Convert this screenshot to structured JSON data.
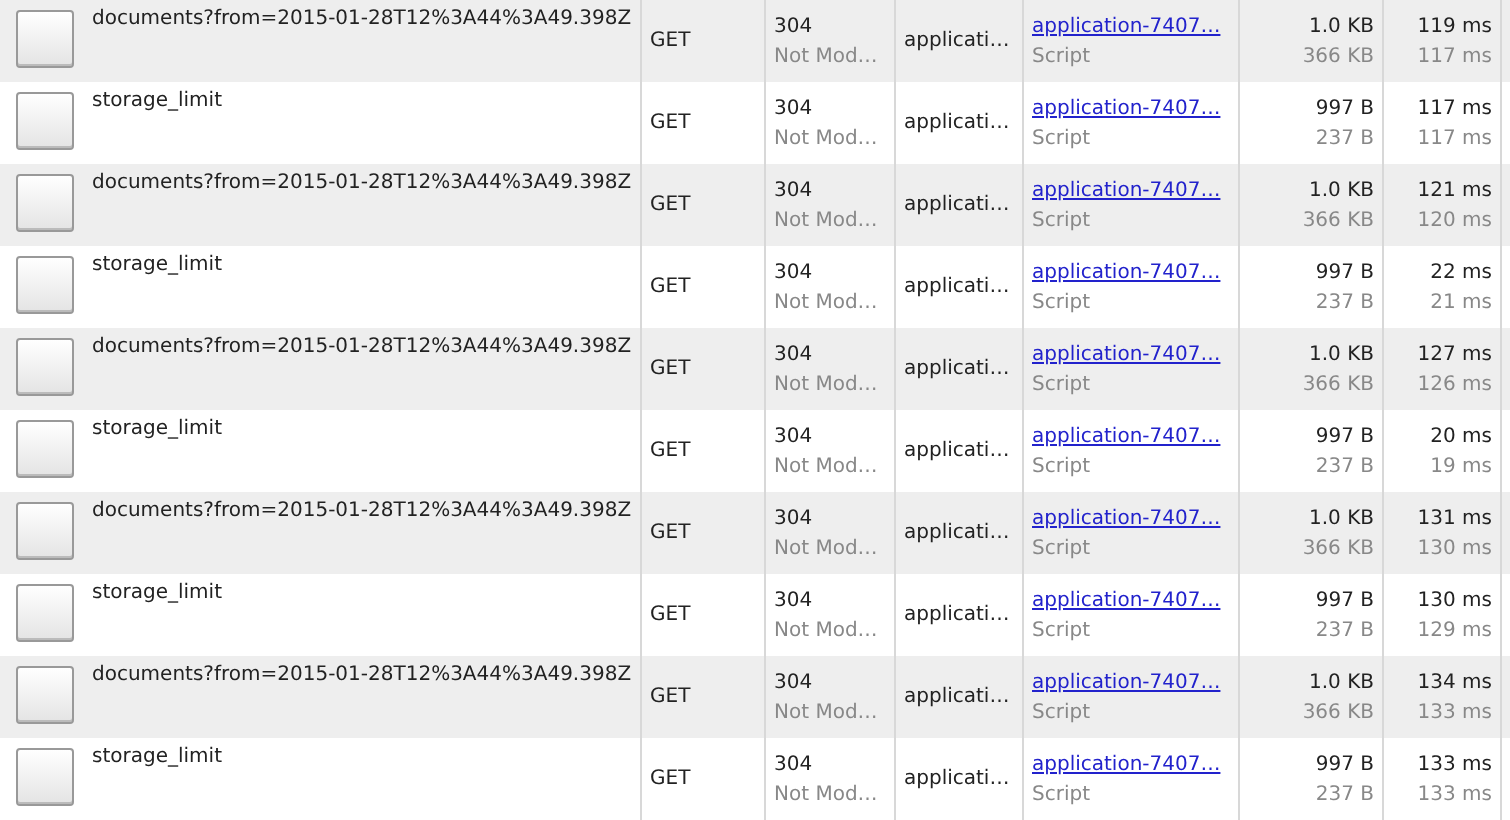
{
  "requests": [
    {
      "name": "documents?from=2015-01-28T12%3A44%3A49.398Z",
      "method": "GET",
      "status": "304",
      "status_text": "Not Mod…",
      "type": "applicati…",
      "initiator": "application-7407…",
      "initiator_type": "Script",
      "size": "1.0 KB",
      "content": "366 KB",
      "time": "119 ms",
      "latency": "117 ms"
    },
    {
      "name": "storage_limit",
      "method": "GET",
      "status": "304",
      "status_text": "Not Mod…",
      "type": "applicati…",
      "initiator": "application-7407…",
      "initiator_type": "Script",
      "size": "997 B",
      "content": "237 B",
      "time": "117 ms",
      "latency": "117 ms"
    },
    {
      "name": "documents?from=2015-01-28T12%3A44%3A49.398Z",
      "method": "GET",
      "status": "304",
      "status_text": "Not Mod…",
      "type": "applicati…",
      "initiator": "application-7407…",
      "initiator_type": "Script",
      "size": "1.0 KB",
      "content": "366 KB",
      "time": "121 ms",
      "latency": "120 ms"
    },
    {
      "name": "storage_limit",
      "method": "GET",
      "status": "304",
      "status_text": "Not Mod…",
      "type": "applicati…",
      "initiator": "application-7407…",
      "initiator_type": "Script",
      "size": "997 B",
      "content": "237 B",
      "time": "22 ms",
      "latency": "21 ms"
    },
    {
      "name": "documents?from=2015-01-28T12%3A44%3A49.398Z",
      "method": "GET",
      "status": "304",
      "status_text": "Not Mod…",
      "type": "applicati…",
      "initiator": "application-7407…",
      "initiator_type": "Script",
      "size": "1.0 KB",
      "content": "366 KB",
      "time": "127 ms",
      "latency": "126 ms"
    },
    {
      "name": "storage_limit",
      "method": "GET",
      "status": "304",
      "status_text": "Not Mod…",
      "type": "applicati…",
      "initiator": "application-7407…",
      "initiator_type": "Script",
      "size": "997 B",
      "content": "237 B",
      "time": "20 ms",
      "latency": "19 ms"
    },
    {
      "name": "documents?from=2015-01-28T12%3A44%3A49.398Z",
      "method": "GET",
      "status": "304",
      "status_text": "Not Mod…",
      "type": "applicati…",
      "initiator": "application-7407…",
      "initiator_type": "Script",
      "size": "1.0 KB",
      "content": "366 KB",
      "time": "131 ms",
      "latency": "130 ms"
    },
    {
      "name": "storage_limit",
      "method": "GET",
      "status": "304",
      "status_text": "Not Mod…",
      "type": "applicati…",
      "initiator": "application-7407…",
      "initiator_type": "Script",
      "size": "997 B",
      "content": "237 B",
      "time": "130 ms",
      "latency": "129 ms"
    },
    {
      "name": "documents?from=2015-01-28T12%3A44%3A49.398Z",
      "method": "GET",
      "status": "304",
      "status_text": "Not Mod…",
      "type": "applicati…",
      "initiator": "application-7407…",
      "initiator_type": "Script",
      "size": "1.0 KB",
      "content": "366 KB",
      "time": "134 ms",
      "latency": "133 ms"
    },
    {
      "name": "storage_limit",
      "method": "GET",
      "status": "304",
      "status_text": "Not Mod…",
      "type": "applicati…",
      "initiator": "application-7407…",
      "initiator_type": "Script",
      "size": "997 B",
      "content": "237 B",
      "time": "133 ms",
      "latency": "133 ms"
    }
  ]
}
